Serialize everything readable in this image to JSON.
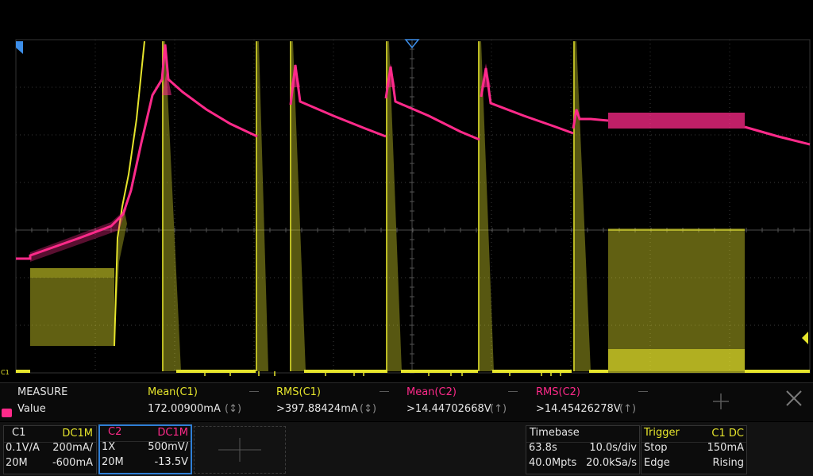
{
  "colors": {
    "ch1": "#e6e52c",
    "ch2": "#ff2a8a",
    "grid": "#3a3a3a",
    "marker_blue": "#3d8ee8"
  },
  "channel_markers": {
    "c1_label": "C1",
    "c2_label": "C2"
  },
  "measure": {
    "header_label": "MEASURE",
    "value_label": "Value",
    "columns": [
      {
        "name": "Mean(C1)",
        "value": "172.00900mA",
        "indicator": "(↕)",
        "color": "#e6e52c"
      },
      {
        "name": "RMS(C1)",
        "value": ">397.88424mA",
        "indicator": "(↕)",
        "color": "#e6e52c"
      },
      {
        "name": "Mean(C2)",
        "value": ">14.44702668V",
        "indicator": "(↑)",
        "color": "#ff2a8a"
      },
      {
        "name": "RMS(C2)",
        "value": ">14.45426278V",
        "indicator": "(↑)",
        "color": "#ff2a8a"
      }
    ],
    "add_icon": "plus-icon",
    "close_icon": "close-icon"
  },
  "c1_box": {
    "title": "C1",
    "coupling": "DC1M",
    "scale": "0.1V/A",
    "value": "200mA/",
    "bandwidth": "20M",
    "offset": "-600mA"
  },
  "c2_box": {
    "title": "C2",
    "coupling": "DC1M",
    "scale": "1X",
    "value": "500mV/",
    "bandwidth": "20M",
    "offset": "-13.5V"
  },
  "timebase": {
    "label": "Timebase",
    "delay": "63.8s",
    "div": "10.0s/div",
    "points": "40.0Mpts",
    "rate": "20.0kSa/s"
  },
  "trigger": {
    "label": "Trigger",
    "source": "C1 DC",
    "state": "Stop",
    "level": "150mA",
    "type": "Edge",
    "slope": "Rising"
  }
}
